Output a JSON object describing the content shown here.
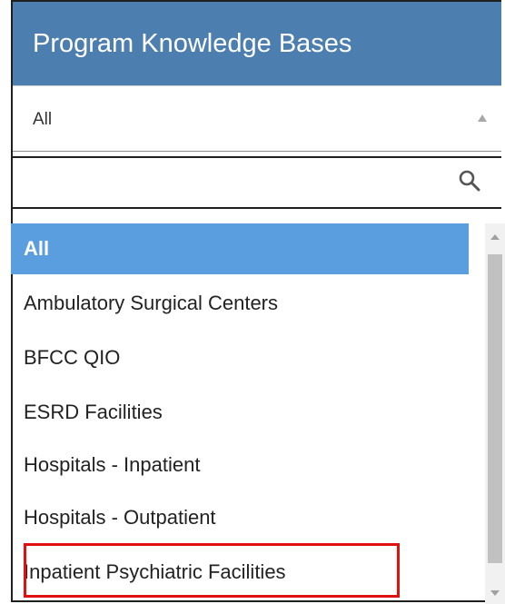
{
  "header": {
    "title": "Program Knowledge Bases"
  },
  "select": {
    "value": "All"
  },
  "search": {
    "value": "",
    "placeholder": "",
    "icon": "search-icon"
  },
  "options": [
    {
      "label": "All",
      "selected": true
    },
    {
      "label": "Ambulatory Surgical Centers",
      "selected": false
    },
    {
      "label": "BFCC QIO",
      "selected": false
    },
    {
      "label": "ESRD Facilities",
      "selected": false
    },
    {
      "label": "Hospitals - Inpatient",
      "selected": false
    },
    {
      "label": "Hospitals - Outpatient",
      "selected": false
    },
    {
      "label": "Inpatient Psychiatric Facilities",
      "selected": false,
      "highlighted": true
    }
  ],
  "colors": {
    "header_bg": "#4d7eb0",
    "selected_bg": "#5b9ee0",
    "highlight_border": "#e01010"
  }
}
